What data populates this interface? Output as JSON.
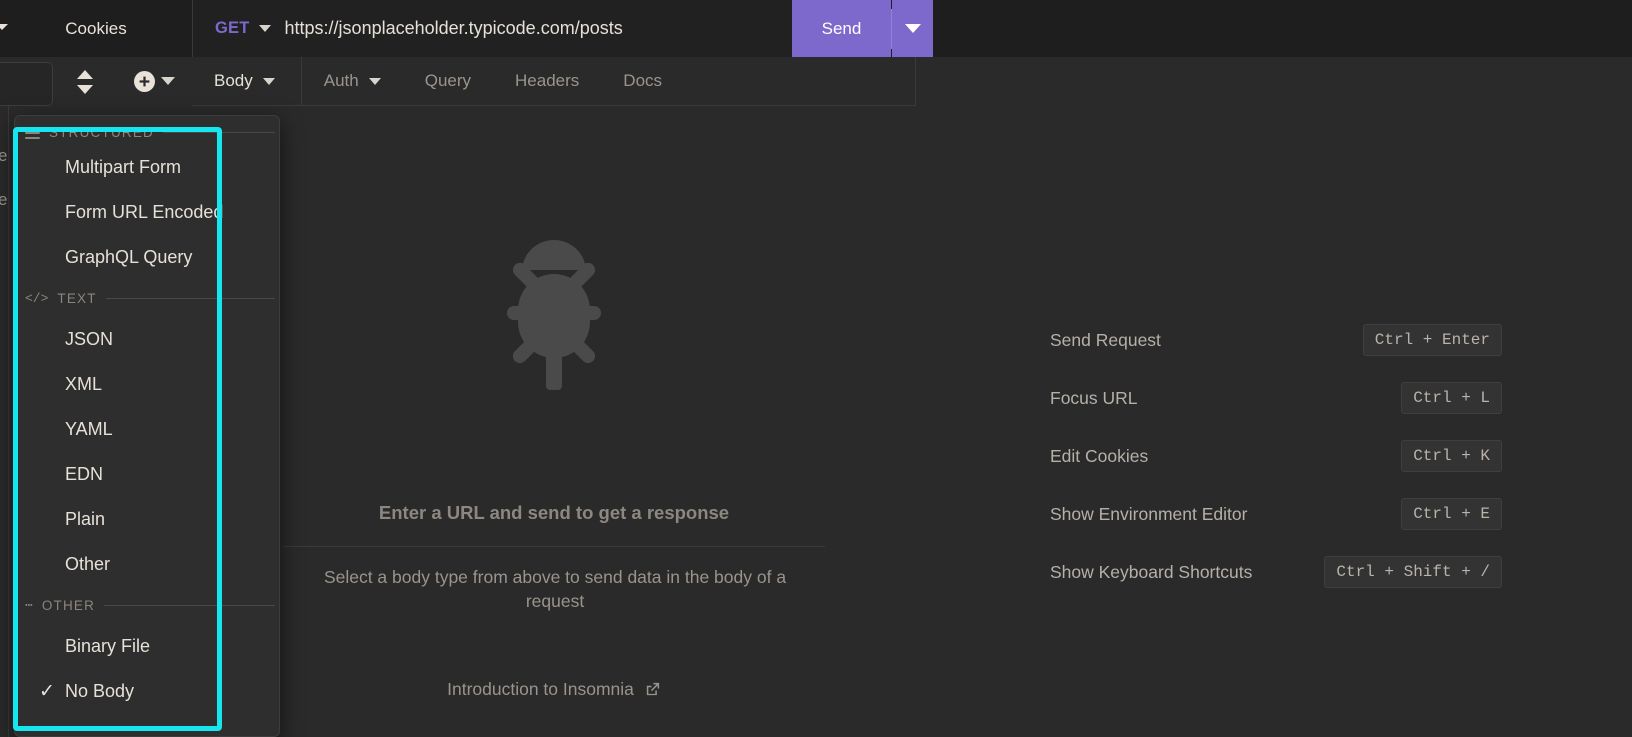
{
  "app": {
    "name": "Insomnia"
  },
  "topbar": {
    "cookies_label": "Cookies",
    "method": "GET",
    "url": "https://jsonplaceholder.typicode.com/posts",
    "send_label": "Send"
  },
  "tabs": [
    {
      "label": "Body",
      "has_caret": true,
      "active": true
    },
    {
      "label": "Auth",
      "has_caret": true,
      "active": false
    },
    {
      "label": "Query",
      "has_caret": false,
      "active": false
    },
    {
      "label": "Headers",
      "has_caret": false,
      "active": false
    },
    {
      "label": "Docs",
      "has_caret": false,
      "active": false
    }
  ],
  "center": {
    "empty_title": "Enter a URL and send to get a response",
    "empty_subtitle": "Select a body type from above to send data in the body of a request",
    "intro_link": "Introduction to Insomnia"
  },
  "shortcuts": {
    "rows": [
      {
        "label": "Send Request",
        "keys": "Ctrl + Enter"
      },
      {
        "label": "Focus URL",
        "keys": "Ctrl + L"
      },
      {
        "label": "Edit Cookies",
        "keys": "Ctrl + K"
      },
      {
        "label": "Show Environment Editor",
        "keys": "Ctrl + E"
      },
      {
        "label": "Show Keyboard Shortcuts",
        "keys": "Ctrl + Shift + /"
      }
    ]
  },
  "body_type_menu": {
    "groups": [
      {
        "icon": "hamburger-icon",
        "label": "STRUCTURED"
      },
      {
        "icon": "code-tags-icon",
        "label": "TEXT"
      },
      {
        "icon": "ellipsis-icon",
        "label": "OTHER"
      }
    ],
    "items": [
      {
        "label": "Multipart Form",
        "checked": false
      },
      {
        "label": "Form URL Encoded",
        "checked": false
      },
      {
        "label": "GraphQL Query",
        "checked": false
      },
      {
        "label": "JSON",
        "checked": false
      },
      {
        "label": "XML",
        "checked": false
      },
      {
        "label": "YAML",
        "checked": false
      },
      {
        "label": "EDN",
        "checked": false
      },
      {
        "label": "Plain",
        "checked": false
      },
      {
        "label": "Other",
        "checked": false
      },
      {
        "label": "Binary File",
        "checked": false
      },
      {
        "label": "No Body",
        "checked": true
      }
    ],
    "check_glyph": "✓"
  },
  "colors": {
    "accent_send": "#7d69cb",
    "method_get": "#7d69cb",
    "highlight_box": "#16e6f0",
    "background": "#2a2a2a",
    "panel": "#2e2e2e",
    "topbar": "#1e1e1e"
  }
}
